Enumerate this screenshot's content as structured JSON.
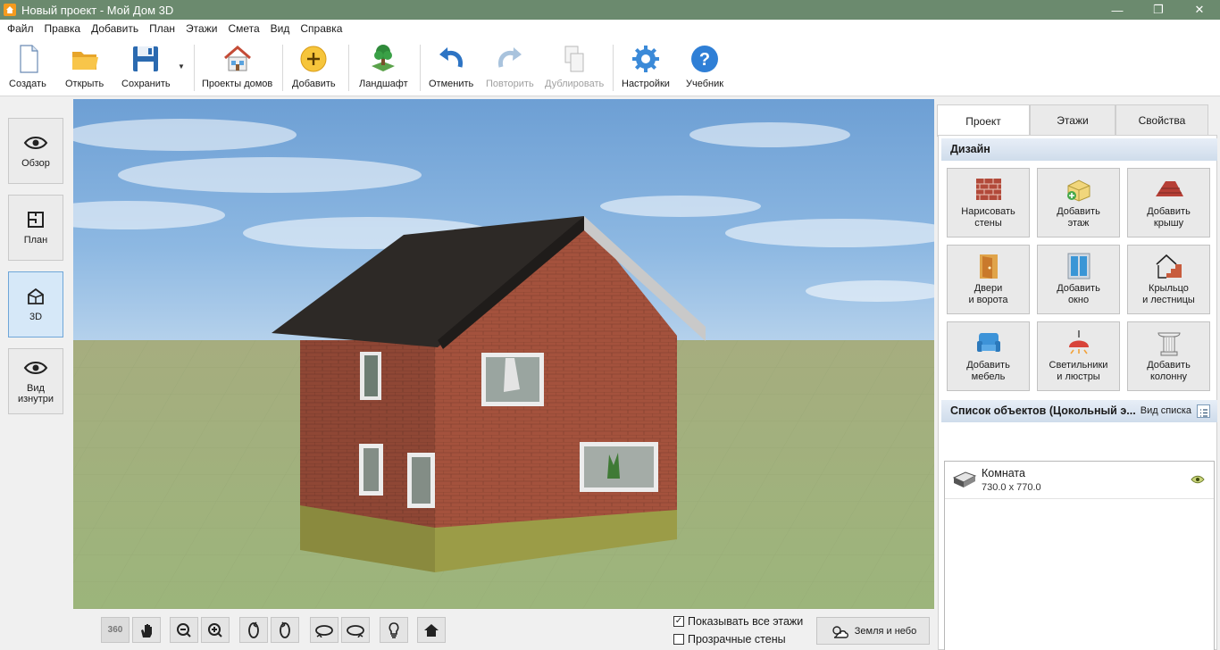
{
  "window": {
    "title": "Новый проект - Мой Дом 3D",
    "controls": [
      "—",
      "❐",
      "✕"
    ]
  },
  "menu": [
    "Файл",
    "Правка",
    "Добавить",
    "План",
    "Этажи",
    "Смета",
    "Вид",
    "Справка"
  ],
  "toolbar": {
    "create": "Создать",
    "open": "Открыть",
    "save": "Сохранить",
    "house_projects": "Проекты домов",
    "add": "Добавить",
    "landscape": "Ландшафт",
    "undo": "Отменить",
    "redo": "Повторить",
    "duplicate": "Дублировать",
    "settings": "Настройки",
    "tutorial": "Учебник"
  },
  "modes": {
    "overview": "Обзор",
    "plan": "План",
    "view3d": "3D",
    "inside_line1": "Вид",
    "inside_line2": "изнутри",
    "active": "3D"
  },
  "bottom": {
    "show_all_floors": "Показывать все этажи",
    "show_all_floors_checked": true,
    "transparent_walls": "Прозрачные стены",
    "transparent_walls_checked": false,
    "ground_sky": "Земля и небо",
    "rotate360_label": "360"
  },
  "tabs": {
    "project": "Проект",
    "floors": "Этажи",
    "properties": "Свойства",
    "active": "Проект"
  },
  "design": {
    "header": "Дизайн",
    "buttons": [
      {
        "line1": "Нарисовать",
        "line2": "стены"
      },
      {
        "line1": "Добавить",
        "line2": "этаж"
      },
      {
        "line1": "Добавить",
        "line2": "крышу"
      },
      {
        "line1": "Двери",
        "line2": "и ворота"
      },
      {
        "line1": "Добавить",
        "line2": "окно"
      },
      {
        "line1": "Крыльцо",
        "line2": "и лестницы"
      },
      {
        "line1": "Добавить",
        "line2": "мебель"
      },
      {
        "line1": "Светильники",
        "line2": "и люстры"
      },
      {
        "line1": "Добавить",
        "line2": "колонну"
      }
    ]
  },
  "objects": {
    "header": "Список объектов (Цокольный э...",
    "list_view": "Вид списка",
    "items": [
      {
        "name": "Комната",
        "size": "730.0 x 770.0"
      }
    ]
  },
  "colors": {
    "titlebar": "#6b8a6e",
    "active_mode": "#d6e8f8",
    "brick": "#a4523d",
    "roof": "#2d2926"
  }
}
